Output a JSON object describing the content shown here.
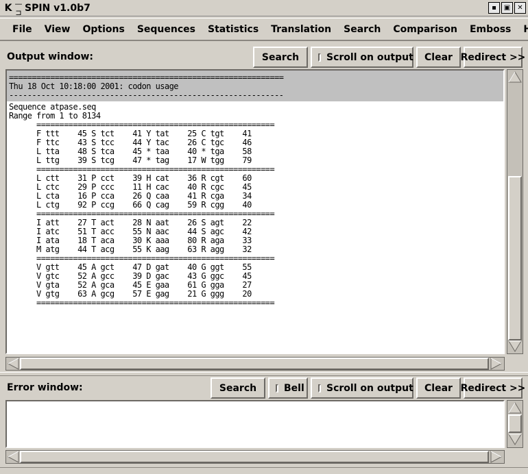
{
  "window": {
    "title": "SPIN v1.0b7",
    "app_icon": "K",
    "pin_icon": "pin-icon"
  },
  "menubar": [
    "File",
    "View",
    "Options",
    "Sequences",
    "Statistics",
    "Translation",
    "Search",
    "Comparison",
    "Emboss",
    "Help"
  ],
  "output_toolbar": {
    "label": "Output window:",
    "search": "Search",
    "scroll_on_output": "Scroll on output",
    "clear": "Clear",
    "redirect": "Redirect >>"
  },
  "error_toolbar": {
    "label": "Error window:",
    "search": "Search",
    "bell": "Bell",
    "scroll_on_output": "Scroll on output",
    "clear": "Clear",
    "redirect": "Redirect >>"
  },
  "output": {
    "header": "============================================================\nThu 18 Oct 10:18:00 2001: codon usage\n------------------------------------------------------------",
    "body": "Sequence atpase.seq\nRange from 1 to 8134\n      ====================================================\n      F ttt    45 S tct    41 Y tat    25 C tgt    41\n      F ttc    43 S tcc    44 Y tac    26 C tgc    46\n      L tta    48 S tca    45 * taa    40 * tga    58\n      L ttg    39 S tcg    47 * tag    17 W tgg    79\n      ====================================================\n      L ctt    31 P cct    39 H cat    36 R cgt    60\n      L ctc    29 P ccc    11 H cac    40 R cgc    45\n      L cta    16 P cca    26 Q caa    41 R cga    34\n      L ctg    92 P ccg    66 Q cag    59 R cgg    40\n      ====================================================\n      I att    27 T act    28 N aat    26 S agt    22\n      I atc    51 T acc    55 N aac    44 S agc    42\n      I ata    18 T aca    30 K aaa    80 R aga    33\n      M atg    44 T acg    55 K aag    63 R agg    32\n      ====================================================\n      V gtt    45 A gct    47 D gat    40 G ggt    55\n      V gtc    52 A gcc    39 D gac    43 G ggc    45\n      V gta    52 A gca    45 E gaa    61 G gga    27\n      V gtg    63 A gcg    57 E gag    21 G ggg    20\n      ===================================================="
  },
  "error": {
    "text": ""
  }
}
